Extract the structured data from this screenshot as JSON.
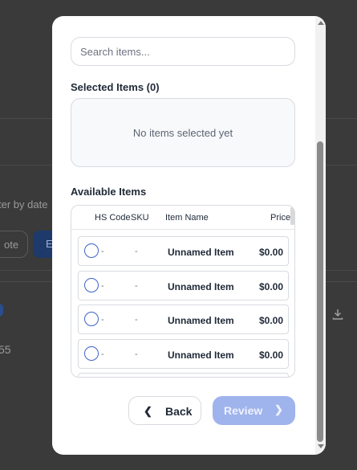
{
  "background": {
    "filter_text": "ter by date",
    "outline_button_label": "ote",
    "blue_button_label": "E",
    "amount_text": "55"
  },
  "modal": {
    "search": {
      "placeholder": "Search items..."
    },
    "selected": {
      "title": "Selected Items (0)",
      "empty_text": "No items selected yet"
    },
    "available": {
      "title": "Available Items",
      "columns": {
        "hs_code": "HS Code",
        "sku": "SKU",
        "item_name": "Item Name",
        "price": "Price"
      },
      "rows": [
        {
          "hs_code": "-",
          "sku": "-",
          "name": "Unnamed Item",
          "price": "$0.00"
        },
        {
          "hs_code": "-",
          "sku": "-",
          "name": "Unnamed Item",
          "price": "$0.00"
        },
        {
          "hs_code": "-",
          "sku": "-",
          "name": "Unnamed Item",
          "price": "$0.00"
        },
        {
          "hs_code": "-",
          "sku": "-",
          "name": "Unnamed Item",
          "price": "$0.00"
        }
      ]
    },
    "footer": {
      "back_label": "Back",
      "back_icon": "chevron-left-icon",
      "review_label": "Review",
      "review_icon": "chevron-right-icon"
    }
  },
  "colors": {
    "accent": "#3d63c7",
    "review_disabled": "#9fb3ec"
  }
}
